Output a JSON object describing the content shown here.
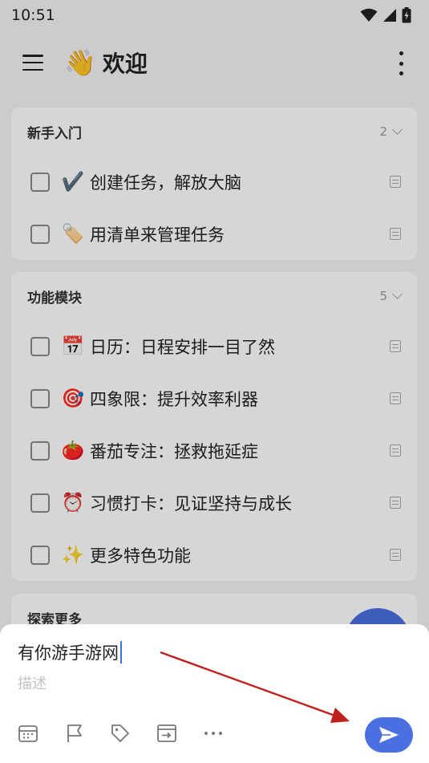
{
  "status_bar": {
    "time": "10:51"
  },
  "header": {
    "title_emoji": "👋",
    "title": "欢迎"
  },
  "sections": [
    {
      "title": "新手入门",
      "count": "2",
      "tasks": [
        {
          "emoji": "✔️",
          "label": "创建任务，解放大脑"
        },
        {
          "emoji": "🏷️",
          "label": "用清单来管理任务"
        }
      ]
    },
    {
      "title": "功能模块",
      "count": "5",
      "tasks": [
        {
          "emoji": "📅",
          "label": "日历：日程安排一目了然"
        },
        {
          "emoji": "🎯",
          "label": "四象限：提升效率利器"
        },
        {
          "emoji": "🍅",
          "label": "番茄专注：拯救拖延症"
        },
        {
          "emoji": "⏰",
          "label": "习惯打卡：见证坚持与成长"
        },
        {
          "emoji": "✨",
          "label": "更多特色功能"
        }
      ]
    },
    {
      "title": "探索更多"
    }
  ],
  "quick_add": {
    "title_value": "有你游手游网",
    "description_placeholder": "描述",
    "tools": [
      "calendar-icon",
      "flag-icon",
      "tag-icon",
      "move-to-list-icon",
      "more-horizontal-icon"
    ]
  },
  "colors": {
    "accent": "#4a6fe0",
    "annotation_arrow": "#c0201c"
  }
}
